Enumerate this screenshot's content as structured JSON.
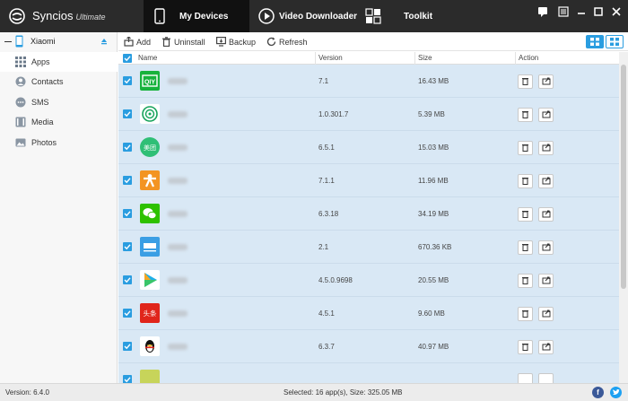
{
  "app": {
    "name": "Syncios",
    "edition": "Ultimate",
    "tabs": [
      {
        "label": "My Devices"
      },
      {
        "label": "Video Downloader"
      },
      {
        "label": "Toolkit"
      }
    ]
  },
  "device": {
    "name": "Xiaomi"
  },
  "sidebar": {
    "items": [
      {
        "label": "Apps",
        "icon": "apps-grid-icon"
      },
      {
        "label": "Contacts",
        "icon": "contacts-icon"
      },
      {
        "label": "SMS",
        "icon": "sms-icon"
      },
      {
        "label": "Media",
        "icon": "media-icon"
      },
      {
        "label": "Photos",
        "icon": "photos-icon"
      }
    ]
  },
  "toolbar": {
    "add": "Add",
    "uninstall": "Uninstall",
    "backup": "Backup",
    "refresh": "Refresh"
  },
  "table": {
    "headers": {
      "name": "Name",
      "version": "Version",
      "size": "Size",
      "action": "Action"
    },
    "rows": [
      {
        "version": "7.1",
        "size": "16.43 MB",
        "icon_color": "#17b23c",
        "icon_text": "QIY"
      },
      {
        "version": "1.0.301.7",
        "size": "5.39 MB",
        "icon_color": "#ffffff",
        "icon_text": ""
      },
      {
        "version": "6.5.1",
        "size": "15.03 MB",
        "icon_color": "#2fbf76",
        "icon_text": "美团"
      },
      {
        "version": "7.1.1",
        "size": "11.96 MB",
        "icon_color": "#f39422",
        "icon_text": ""
      },
      {
        "version": "6.3.18",
        "size": "34.19 MB",
        "icon_color": "#2dc100",
        "icon_text": ""
      },
      {
        "version": "2.1",
        "size": "670.36 KB",
        "icon_color": "#3a9ee4",
        "icon_text": ""
      },
      {
        "version": "4.5.0.9698",
        "size": "20.55 MB",
        "icon_color": "#ffffff",
        "icon_text": ""
      },
      {
        "version": "4.5.1",
        "size": "9.60 MB",
        "icon_color": "#e0251b",
        "icon_text": "头条"
      },
      {
        "version": "6.3.7",
        "size": "40.97 MB",
        "icon_color": "#ffffff",
        "icon_text": ""
      }
    ]
  },
  "status": {
    "version": "Version: 6.4.0",
    "selected": "Selected: 16 app(s), Size: 325.05 MB"
  },
  "colors": {
    "accent": "#2a9de0",
    "titlebar": "#2b2b2b",
    "row_bg": "#d9e8f5"
  }
}
